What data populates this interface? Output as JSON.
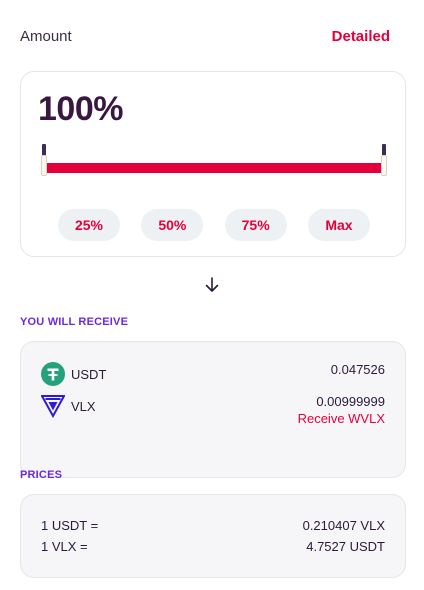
{
  "header": {
    "label": "Amount",
    "toggle": "Detailed"
  },
  "amount": {
    "percent_text": "100%",
    "slider_value_percent": 100,
    "presets": [
      "25%",
      "50%",
      "75%",
      "Max"
    ]
  },
  "receive": {
    "title": "YOU WILL RECEIVE",
    "items": [
      {
        "symbol": "USDT",
        "amount": "0.047526",
        "icon": "tether-icon"
      },
      {
        "symbol": "VLX",
        "amount": "0.00999999",
        "icon": "velas-icon",
        "action": "Receive WVLX"
      }
    ]
  },
  "prices": {
    "title": "PRICES",
    "rows": [
      {
        "label": "1 USDT =",
        "value": "0.210407 VLX"
      },
      {
        "label": "1 VLX =",
        "value": "4.7527 USDT"
      }
    ]
  },
  "colors": {
    "accent": "#e4003a",
    "section": "#6a2bd9",
    "tether": "#26a17b",
    "velas": "#2e1bd6"
  }
}
